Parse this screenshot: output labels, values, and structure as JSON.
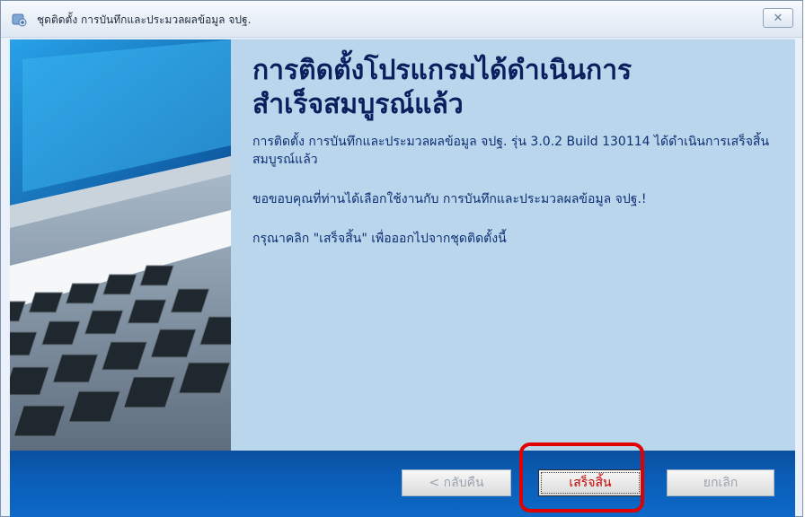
{
  "window": {
    "title": "ชุดติดตั้ง การบันทึกและประมวลผลข้อมูล จปฐ.",
    "close_label": "✕"
  },
  "content": {
    "headline": "การติดตั้งโปรแกรมได้ดำเนินการ\nสำเร็จสมบูรณ์แล้ว",
    "paragraph1": "การติดตั้ง การบันทึกและประมวลผลข้อมูล จปฐ. รุ่น 3.0.2 Build 130114 ได้ดำเนินการเสร็จสิ้นสมบูรณ์แล้ว",
    "paragraph2": "ขอขอบคุณที่ท่านได้เลือกใช้งานกับ การบันทึกและประมวลผลข้อมูล จปฐ.!",
    "paragraph3": "กรุณาคลิก \"เสร็จสิ้น\" เพื่อออกไปจากชุดติดตั้งนี้"
  },
  "buttons": {
    "back": "< กลับคืน",
    "finish": "เสร็จสิ้น",
    "cancel": "ยกเลิก"
  },
  "colors": {
    "title_text": "#07215e",
    "content_bg": "#bad6ec",
    "bottom_bar": "#0a5db6",
    "highlight": "#e00000"
  },
  "icons": {
    "app": "installer-icon",
    "close": "close-icon"
  }
}
